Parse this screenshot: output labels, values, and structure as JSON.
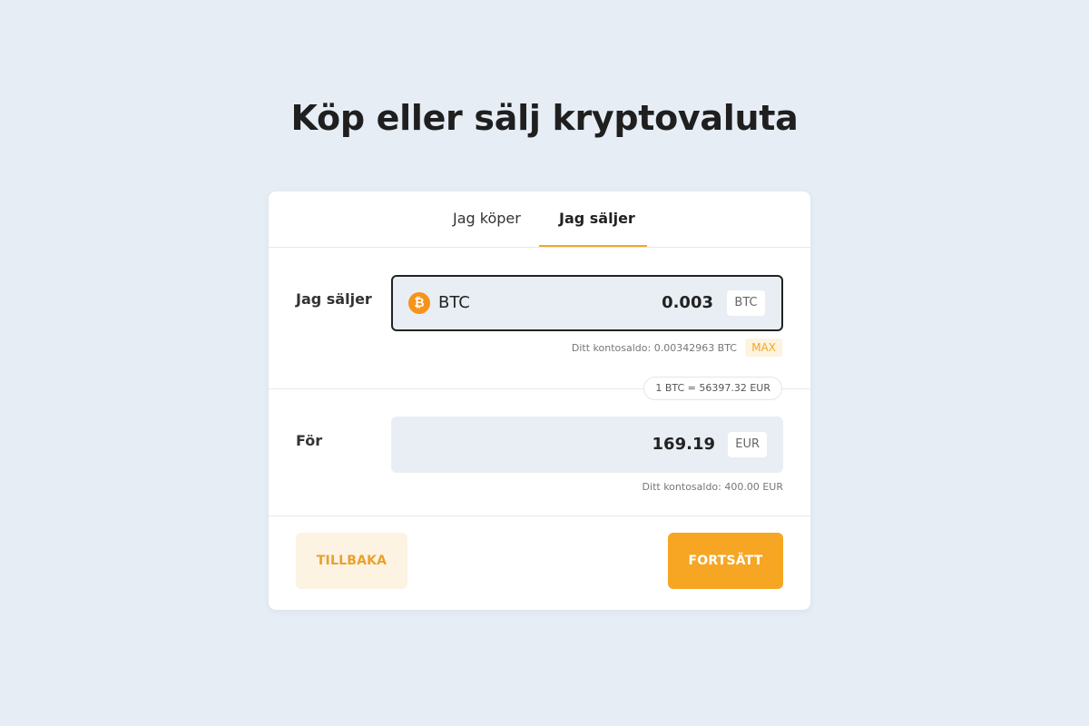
{
  "page": {
    "title": "Köp eller sälj kryptovaluta"
  },
  "tabs": [
    {
      "label": "Jag köper",
      "active": false
    },
    {
      "label": "Jag säljer",
      "active": true
    }
  ],
  "sell_section": {
    "label": "Jag säljer",
    "currency_name": "BTC",
    "currency_icon": "bitcoin-icon",
    "currency_glyph": "₿",
    "amount": "0.003",
    "unit": "BTC",
    "balance_text": "Ditt kontosaldo: 0.00342963 BTC",
    "max_label": "MAX"
  },
  "rate": {
    "text": "1 BTC = 56397.32 EUR"
  },
  "for_section": {
    "label": "För",
    "amount": "169.19",
    "unit": "EUR",
    "balance_text": "Ditt kontosaldo: 400.00 EUR"
  },
  "actions": {
    "back_label": "TILLBAKA",
    "continue_label": "FORTSÄTT"
  },
  "colors": {
    "background": "#e6edf5",
    "accent": "#f6a623",
    "accent_soft": "#fdf3e3",
    "field_bg": "#e8eef4",
    "bitcoin": "#f7931a"
  }
}
